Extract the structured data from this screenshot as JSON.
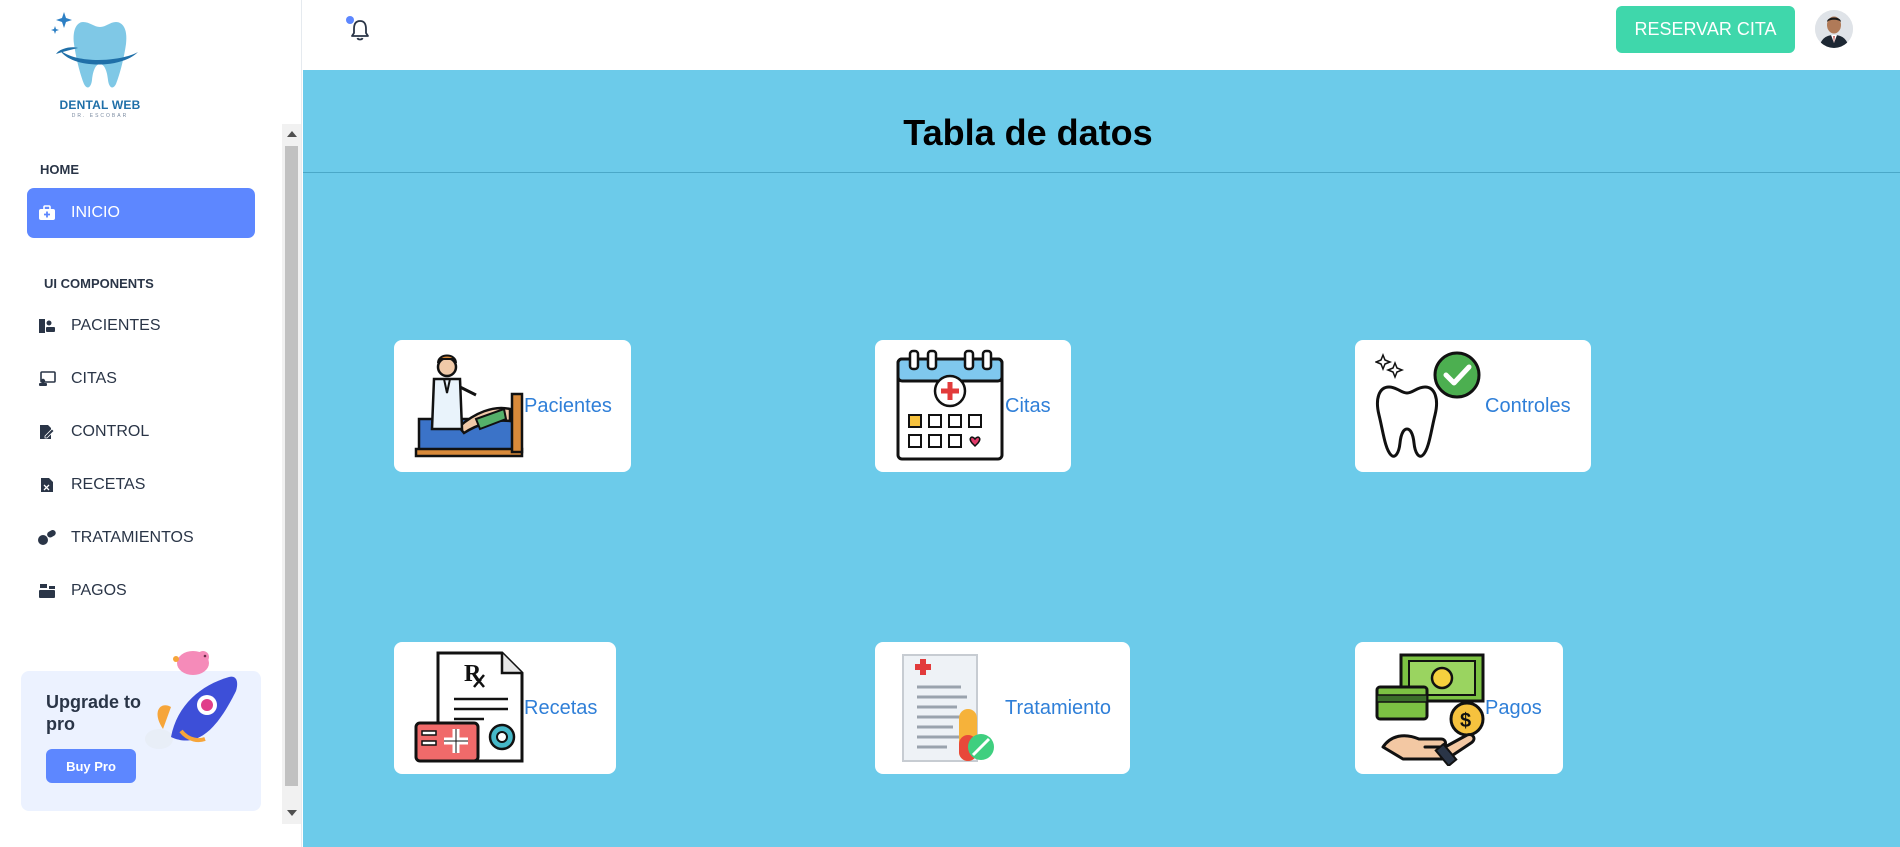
{
  "sidebar": {
    "brand": "DENTAL WEB",
    "brand_sub": "DR. ESCOBAR",
    "sections": [
      {
        "title": "HOME"
      },
      {
        "title": "UI COMPONENTS"
      }
    ],
    "items": [
      {
        "label": "INICIO",
        "icon": "medical-kit-icon",
        "active": true
      },
      {
        "label": "PACIENTES",
        "icon": "patient-icon"
      },
      {
        "label": "CITAS",
        "icon": "appointment-icon"
      },
      {
        "label": "CONTROL",
        "icon": "edit-file-icon"
      },
      {
        "label": "RECETAS",
        "icon": "prescription-icon"
      },
      {
        "label": "TRATAMIENTOS",
        "icon": "pills-icon"
      },
      {
        "label": "PAGOS",
        "icon": "cash-register-icon"
      }
    ],
    "upgrade": {
      "title": "Upgrade to pro",
      "button": "Buy Pro"
    }
  },
  "header": {
    "reserve_button": "RESERVAR CITA",
    "notification_icon": "bell-icon"
  },
  "main": {
    "title": "Tabla de datos",
    "cards": [
      {
        "label": "Pacientes",
        "icon": "doctor-patient-icon"
      },
      {
        "label": "Citas",
        "icon": "calendar-icon"
      },
      {
        "label": "Controles",
        "icon": "tooth-check-icon"
      },
      {
        "label": "Recetas",
        "icon": "prescription-doc-icon"
      },
      {
        "label": "Tratamiento",
        "icon": "medical-report-icon"
      },
      {
        "label": "Pagos",
        "icon": "payment-icon"
      }
    ]
  },
  "colors": {
    "accent": "#5d87ff",
    "reserve": "#3fd7ab",
    "main_bg": "#6ccbea",
    "card_label": "#2f7fd8"
  }
}
